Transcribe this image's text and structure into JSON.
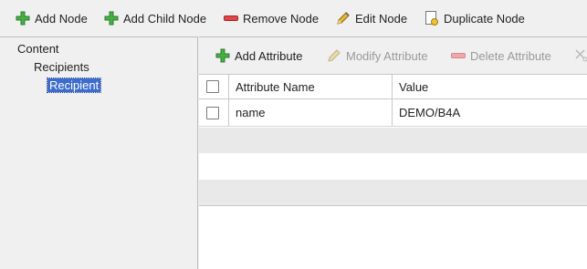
{
  "toolbar": {
    "add_node": "Add Node",
    "add_child_node": "Add Child Node",
    "remove_node": "Remove Node",
    "edit_node": "Edit Node",
    "duplicate_node": "Duplicate Node"
  },
  "tree": {
    "items": [
      {
        "label": "Content",
        "level": 0,
        "selected": false
      },
      {
        "label": "Recipients",
        "level": 1,
        "selected": false
      },
      {
        "label": "Recipient",
        "level": 2,
        "selected": true
      }
    ]
  },
  "attributes_toolbar": {
    "add_attribute": "Add Attribute",
    "modify_attribute": "Modify Attribute",
    "delete_attribute": "Delete Attribute"
  },
  "attributes_table": {
    "columns": [
      "Attribute Name",
      "Value"
    ],
    "rows": [
      {
        "name": "name",
        "value": "DEMO/B4A",
        "checked": false
      }
    ]
  },
  "colors": {
    "add_green": "#3aa33a",
    "remove_red": "#e04646",
    "selection_blue": "#3d6ccd",
    "disabled_text": "#9a9a9a"
  }
}
